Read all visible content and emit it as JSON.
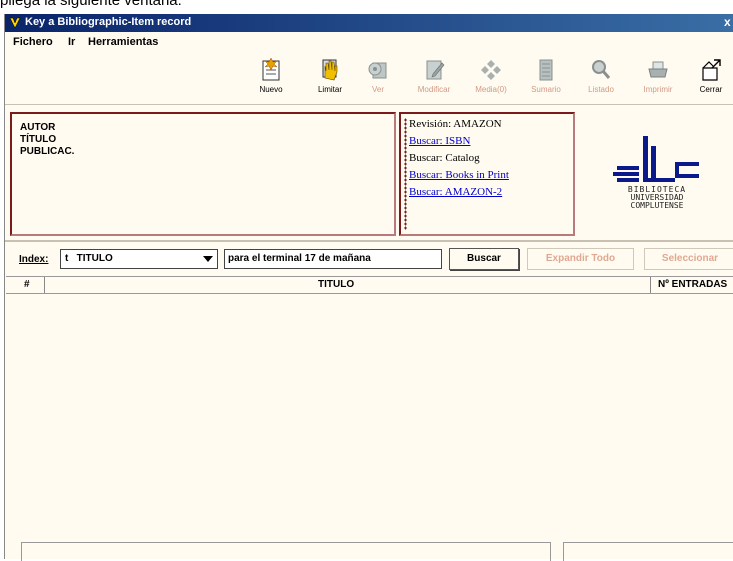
{
  "document_text": "pliega la siguiente ventana:",
  "window": {
    "title": "Key a Bibliographic-Item record",
    "close_label": "x"
  },
  "menu": [
    {
      "label": "Fichero"
    },
    {
      "label": "Ir"
    },
    {
      "label": "Herramientas"
    }
  ],
  "toolbar": [
    {
      "label": "Nuevo",
      "enabled": true,
      "icon": "new-record-icon"
    },
    {
      "label": "Limitar",
      "enabled": true,
      "icon": "limit-hand-icon"
    },
    {
      "label": "Ver",
      "enabled": false,
      "icon": "view-icon"
    },
    {
      "label": "Modificar",
      "enabled": false,
      "icon": "modify-icon"
    },
    {
      "label": "Media(0)",
      "enabled": false,
      "icon": "media-icon"
    },
    {
      "label": "Sumario",
      "enabled": false,
      "icon": "summary-icon"
    },
    {
      "label": "Listado",
      "enabled": false,
      "icon": "magnifier-icon"
    },
    {
      "label": "Imprimir",
      "enabled": false,
      "icon": "printer-icon"
    },
    {
      "label": "Cerrar",
      "enabled": true,
      "icon": "close-box-icon"
    }
  ],
  "record_fields": [
    "AUTOR",
    "TÍTULO",
    "PUBLICAC."
  ],
  "links": [
    {
      "text": "Revisión: AMAZON",
      "link": false
    },
    {
      "text": "Buscar: ISBN",
      "link": true
    },
    {
      "text": "Buscar: Catalog",
      "link": false
    },
    {
      "text": "Buscar: Books in Print",
      "link": true
    },
    {
      "text": "Buscar: AMAZON-2",
      "link": true
    }
  ],
  "logo": {
    "line1": "BIBLIOTECA",
    "line2": "UNIVERSIDAD",
    "line3": "COMPLUTENSE"
  },
  "search": {
    "index_label": "Index:",
    "index_value": "t   TITULO",
    "query": "para el terminal 17 de mañana",
    "search_button": "Buscar",
    "expand_button": "Expandir Todo",
    "select_button": "Seleccionar"
  },
  "grid": {
    "columns": [
      "#",
      "TITULO",
      "Nº ENTRADAS"
    ]
  },
  "colors": {
    "titlebar": "#0a246a",
    "panel_border": "#7a1a1a",
    "background": "#fffbf0",
    "disabled_text": "#d39a85",
    "link": "#0000cc"
  }
}
